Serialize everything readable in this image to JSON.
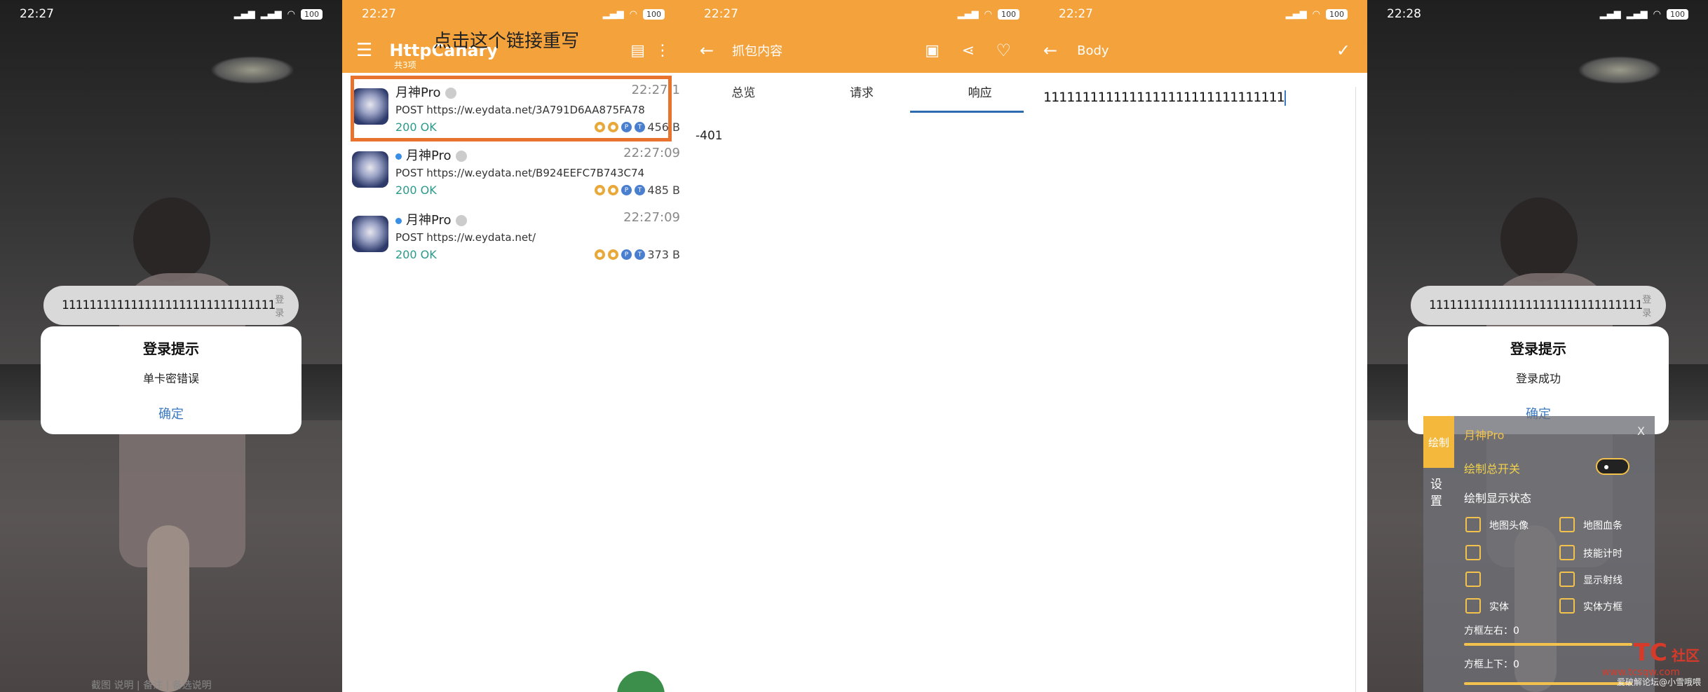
{
  "panel1": {
    "time": "22:27",
    "battery": "100",
    "input_value": "1111111111111111111111111111111",
    "input_hint": "登录",
    "dialog_title": "登录提示",
    "dialog_message": "单卡密错误",
    "dialog_ok": "确定",
    "bottom_note": "截图 说明 | 备注 | 备选说明"
  },
  "panel2": {
    "time": "22:27",
    "battery": "100",
    "app_title": "HttpCanary",
    "app_subtitle": "共3项",
    "overlay_text": "点击这个链接重写",
    "requests": [
      {
        "app": "月神Pro",
        "time": "22:27:1",
        "url": "POST https://w.eydata.net/3A791D6AA875FA78",
        "status": "200 OK",
        "size": "456 B",
        "dot": false
      },
      {
        "app": "月神Pro",
        "time": "22:27:09",
        "url": "POST https://w.eydata.net/B924EEFC7B743C74",
        "status": "200 OK",
        "size": "485 B",
        "dot": true
      },
      {
        "app": "月神Pro",
        "time": "22:27:09",
        "url": "POST https://w.eydata.net/",
        "status": "200 OK",
        "size": "373 B",
        "dot": true
      }
    ]
  },
  "panel3": {
    "time": "22:27",
    "battery": "100",
    "title": "抓包内容",
    "tabs": [
      "总览",
      "请求",
      "响应"
    ],
    "active_tab": "响应",
    "response_body": "-401"
  },
  "panel4": {
    "time": "22:27",
    "battery": "100",
    "title": "Body",
    "body_value": "1111111111111111111111111111111"
  },
  "panel5": {
    "time": "22:28",
    "battery": "100",
    "input_value": "1111111111111111111111111111111",
    "input_hint": "登录",
    "dialog_title": "登录提示",
    "dialog_message": "登录成功",
    "dialog_ok": "确定",
    "menu": {
      "side_label": "绘制",
      "title": "月神Pro",
      "close": "X",
      "setting": "设置",
      "master_switch": "绘制总开关",
      "display_state": "绘制显示状态",
      "options": [
        "地图头像",
        "地图血条",
        "",
        "技能计时",
        "",
        "显示射线",
        "实体",
        "实体方框"
      ],
      "slider1_label": "方框左右：0",
      "slider2_label": "方框上下：0"
    },
    "watermark": "爱破解论坛@小雪哦喂",
    "tc_logo": "TC",
    "tc_text": "社区",
    "tc_url": "www.tcsqw.com"
  },
  "colors": {
    "accent_orange": "#f4a23c",
    "link_blue": "#3a78c2",
    "status_green": "#2a9a8a",
    "highlight": "#e8732f"
  }
}
